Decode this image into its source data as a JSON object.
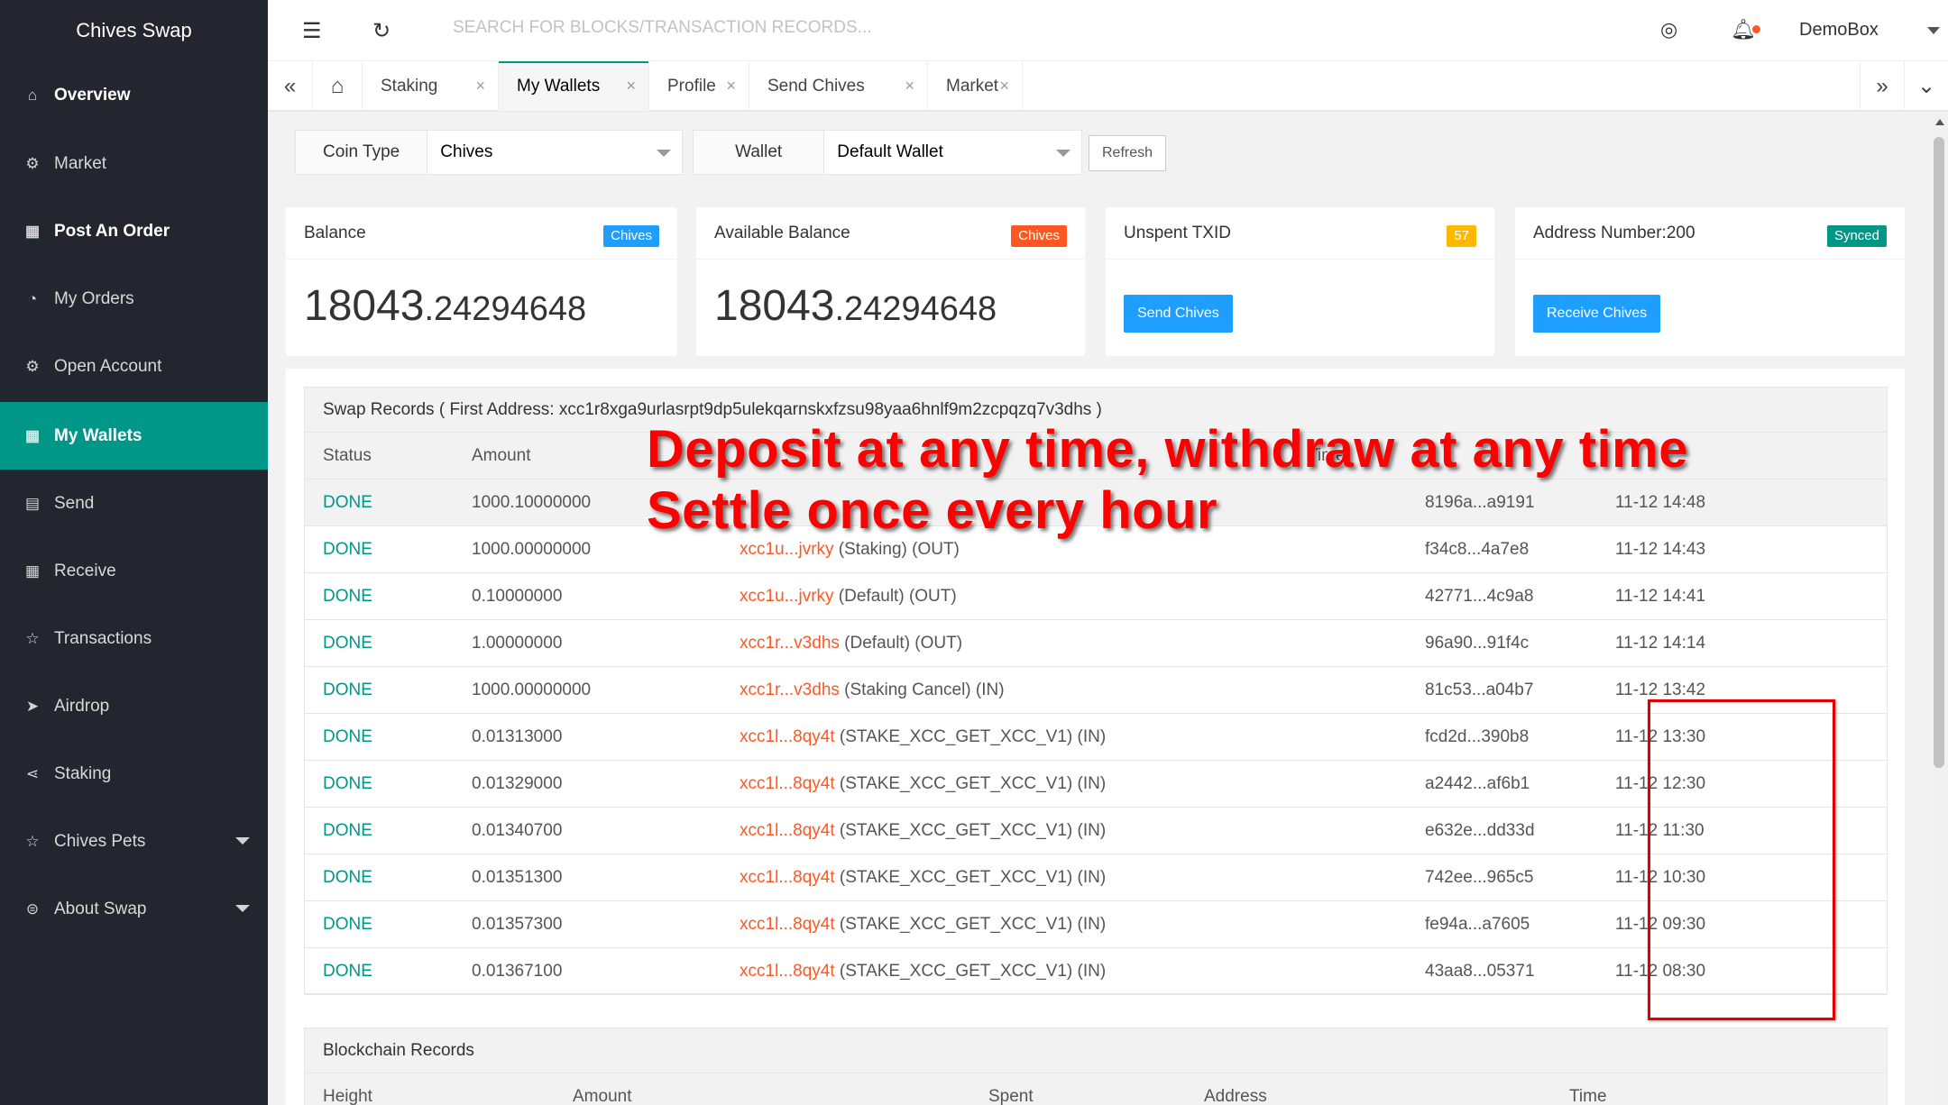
{
  "app": {
    "title": "Chives Swap"
  },
  "sidebar": {
    "items": [
      {
        "label": "Overview",
        "icon": "home-icon",
        "glyph": "⌂"
      },
      {
        "label": "Market",
        "icon": "gear-icon",
        "glyph": "⚙"
      },
      {
        "label": "Post An Order",
        "icon": "list-icon",
        "glyph": "▦"
      },
      {
        "label": "My Orders",
        "icon": "gauge-icon",
        "glyph": "◔"
      },
      {
        "label": "Open Account",
        "icon": "gear-icon",
        "glyph": "⚙"
      },
      {
        "label": "My Wallets",
        "icon": "list-icon",
        "glyph": "▦"
      },
      {
        "label": "Send",
        "icon": "list-icon",
        "glyph": "▤"
      },
      {
        "label": "Receive",
        "icon": "list-icon",
        "glyph": "▦"
      },
      {
        "label": "Transactions",
        "icon": "star-icon",
        "glyph": "☆"
      },
      {
        "label": "Airdrop",
        "icon": "send-icon",
        "glyph": "➤"
      },
      {
        "label": "Staking",
        "icon": "share-icon",
        "glyph": "⋖"
      },
      {
        "label": "Chives Pets",
        "icon": "star-icon",
        "glyph": "☆"
      },
      {
        "label": "About Swap",
        "icon": "info-icon",
        "glyph": "⊜"
      }
    ],
    "active_index": 5
  },
  "header": {
    "search_placeholder": "SEARCH FOR BLOCKS/TRANSACTION RECORDS...",
    "user": "DemoBox"
  },
  "tabs": [
    {
      "label": "Staking"
    },
    {
      "label": "My Wallets"
    },
    {
      "label": "Profile"
    },
    {
      "label": "Send Chives"
    },
    {
      "label": "Market"
    }
  ],
  "active_tab": 1,
  "filters": {
    "coin_type_label": "Coin Type",
    "coin_type_value": "Chives",
    "wallet_label": "Wallet",
    "wallet_value": "Default Wallet",
    "refresh_label": "Refresh"
  },
  "cards": {
    "balance": {
      "title": "Balance",
      "badge": "Chives",
      "int": "18043",
      "frac": ".24294648"
    },
    "available": {
      "title": "Available Balance",
      "badge": "Chives",
      "int": "18043",
      "frac": ".24294648"
    },
    "unspent": {
      "title": "Unspent TXID",
      "badge": "57",
      "button": "Send Chives"
    },
    "address": {
      "title": "Address Number:200",
      "badge": "Synced",
      "button": "Receive Chives"
    }
  },
  "colors": {
    "sidebar_bg": "#23262e",
    "accent": "#009688",
    "blue": "#1e9fff",
    "orange": "#ff5722",
    "yellow": "#ffb800"
  },
  "swap": {
    "title": "Swap Records ( First Address: xcc1r8xga9urlasrpt9dp5ulekqarnskxfzsu98yaa6hnlf9m2zcpqzq7v3dhs )",
    "headers": {
      "status": "Status",
      "amount": "Amount",
      "time": "Time"
    },
    "rows": [
      {
        "status": "DONE",
        "amount": "1000.10000000",
        "addr": "",
        "rest": "",
        "txid": "8196a...a9191",
        "time": "11-12 14:48"
      },
      {
        "status": "DONE",
        "amount": "1000.00000000",
        "addr": "xcc1u...jvrky",
        "rest": " (Staking) (OUT)",
        "txid": "f34c8...4a7e8",
        "time": "11-12 14:43"
      },
      {
        "status": "DONE",
        "amount": "0.10000000",
        "addr": "xcc1u...jvrky",
        "rest": " (Default) (OUT)",
        "txid": "42771...4c9a8",
        "time": "11-12 14:41"
      },
      {
        "status": "DONE",
        "amount": "1.00000000",
        "addr": "xcc1r...v3dhs",
        "rest": " (Default) (OUT)",
        "txid": "96a90...91f4c",
        "time": "11-12 14:14"
      },
      {
        "status": "DONE",
        "amount": "1000.00000000",
        "addr": "xcc1r...v3dhs",
        "rest": " (Staking Cancel) (IN)",
        "txid": "81c53...a04b7",
        "time": "11-12 13:42"
      },
      {
        "status": "DONE",
        "amount": "0.01313000",
        "addr": "xcc1l...8qy4t",
        "rest": " (STAKE_XCC_GET_XCC_V1) (IN)",
        "txid": "fcd2d...390b8",
        "time": "11-12 13:30"
      },
      {
        "status": "DONE",
        "amount": "0.01329000",
        "addr": "xcc1l...8qy4t",
        "rest": " (STAKE_XCC_GET_XCC_V1) (IN)",
        "txid": "a2442...af6b1",
        "time": "11-12 12:30"
      },
      {
        "status": "DONE",
        "amount": "0.01340700",
        "addr": "xcc1l...8qy4t",
        "rest": " (STAKE_XCC_GET_XCC_V1) (IN)",
        "txid": "e632e...dd33d",
        "time": "11-12 11:30"
      },
      {
        "status": "DONE",
        "amount": "0.01351300",
        "addr": "xcc1l...8qy4t",
        "rest": " (STAKE_XCC_GET_XCC_V1) (IN)",
        "txid": "742ee...965c5",
        "time": "11-12 10:30"
      },
      {
        "status": "DONE",
        "amount": "0.01357300",
        "addr": "xcc1l...8qy4t",
        "rest": " (STAKE_XCC_GET_XCC_V1) (IN)",
        "txid": "fe94a...a7605",
        "time": "11-12 09:30"
      },
      {
        "status": "DONE",
        "amount": "0.01367100",
        "addr": "xcc1l...8qy4t",
        "rest": " (STAKE_XCC_GET_XCC_V1) (IN)",
        "txid": "43aa8...05371",
        "time": "11-12 08:30"
      }
    ]
  },
  "blockchain": {
    "title": "Blockchain Records",
    "headers": {
      "height": "Height",
      "amount": "Amount",
      "spent": "Spent",
      "address": "Address",
      "time": "Time"
    }
  },
  "overlay": {
    "line1": "Deposit at any time, withdraw at any time",
    "line2": "Settle once every hour"
  }
}
